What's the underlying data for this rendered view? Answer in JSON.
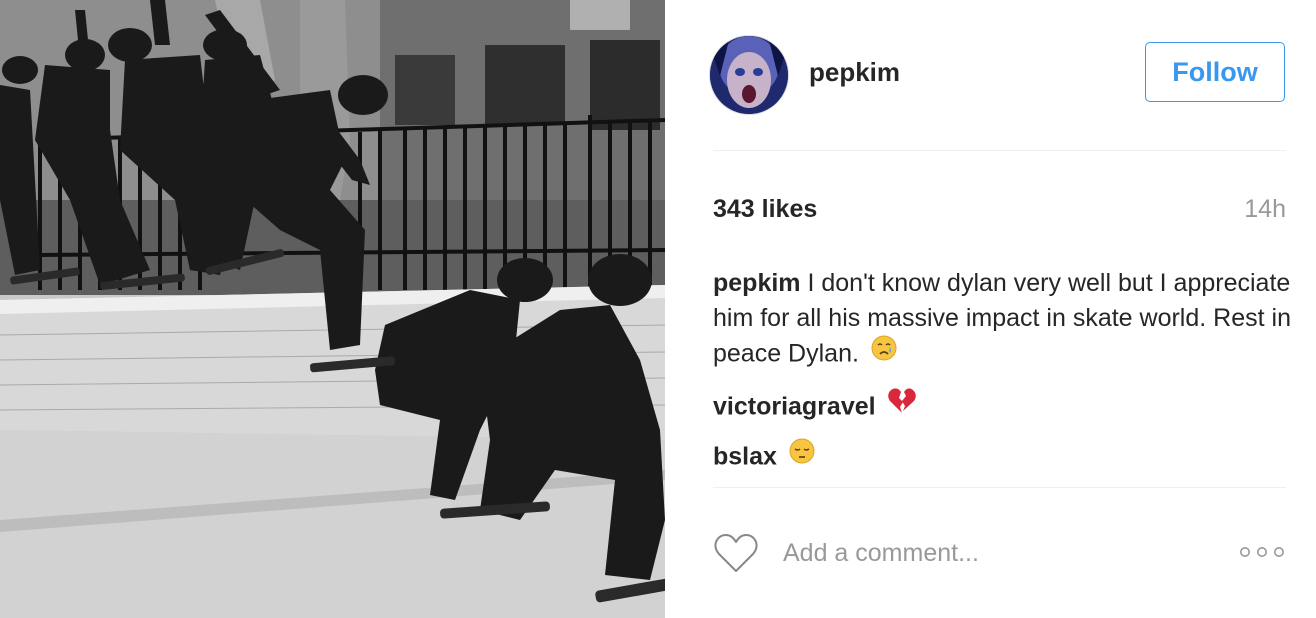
{
  "post": {
    "image_alt_icon": "photo-skateboard-sequence",
    "author": {
      "username": "pepkim",
      "avatar_icon": "avatar-portrait"
    },
    "follow_label": "Follow",
    "likes_text": "343 likes",
    "timestamp": "14h",
    "comments": [
      {
        "author": "pepkim",
        "text": "I don't know dylan very well but I appreciate him for all his massive impact in skate world. Rest in peace Dylan.",
        "emoji": "crying-face"
      },
      {
        "author": "victoriagravel",
        "text": "",
        "emoji": "broken-heart"
      },
      {
        "author": "bslax",
        "text": "",
        "emoji": "pensive-face"
      }
    ],
    "add_comment_placeholder": "Add a comment...",
    "like_icon": "heart-outline-icon",
    "more_icon": "ellipsis-icon"
  },
  "colors": {
    "accent": "#3897f0",
    "text": "#262626",
    "muted": "#999999",
    "divider": "#efefef"
  }
}
